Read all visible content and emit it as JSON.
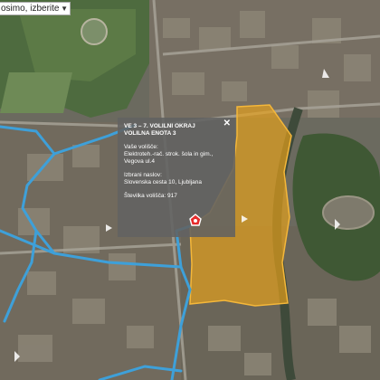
{
  "search": {
    "value": "osimo, izberite"
  },
  "popup": {
    "title_line1": "VE 3 – 7. VOLILNI OKRAJ",
    "title_line2": "VOLILNA ENOTA 3",
    "voters_label": "Vaše volišče:",
    "voters_line1": "Elektroteh.-rač. strok. šola in gim.,",
    "voters_line2": "Vegova ul.4",
    "address_label": "Izbrani naslov:",
    "address_value": "Slovenska cesta 10, Ljubljana",
    "number": "Številka volišča: 917",
    "close": "✕"
  },
  "icons": {
    "close": "close-icon",
    "marker": "location-marker-icon",
    "dropdown": "chevron-down-icon"
  },
  "colors": {
    "highlight": "#e8a21a",
    "route": "#3ea0d9",
    "popup_bg": "#626262"
  }
}
